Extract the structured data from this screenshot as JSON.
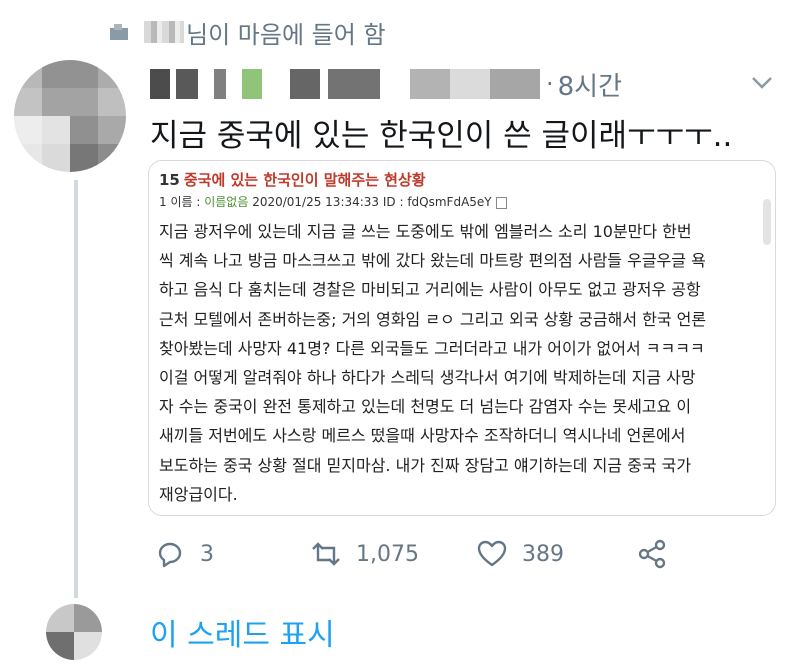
{
  "social_context": {
    "text": "님이 마음에 들어 함",
    "icon": "heart-liked-icon"
  },
  "tweet": {
    "time": "8시간",
    "dot": "·",
    "text": "지금 중국에 있는 한국인이 쓴 글이래ㅜㅜㅜ..",
    "quote": {
      "number": "15",
      "title": "중국에 있는 한국인이 말해주는 현상황",
      "meta_prefix": "1 이름 : ",
      "meta_name": "이름없음",
      "meta_rest": " 2020/01/25 13:34:33 ID : fdQsmFdA5eY",
      "lines": [
        "지금 광저우에 있는데 지금 글 쓰는 도중에도 밖에 엠블러스 소리 10분만다 한번",
        "씩 계속 나고 방금 마스크쓰고 밖에 갔다 왔는데 마트랑 편의점 사람들 우글우글 욕",
        "하고 음식 다 훔치는데 경찰은 마비되고 거리에는 사람이 아무도 없고 광저우 공항",
        "근처 모텔에서 존버하는중; 거의 영화임 ㄹㅇ 그리고 외국 상황 궁금해서 한국 언론",
        "찾아봤는데 사망자 41명? 다른 외국들도 그러더라고 내가 어이가 없어서 ㅋㅋㅋㅋ",
        "이걸 어떻게 알려줘야 하나 하다가 스레딕 생각나서 여기에 박제하는데 지금 사망",
        "자 수는 중국이 완전 통제하고 있는데 천명도 더 넘는다 감염자 수는 못세고요 이",
        "새끼들 저번에도 사스랑 메르스 떴을때 사망자수 조작하더니 역시나네 언론에서",
        "보도하는 중국 상황 절대 믿지마삼. 내가 진짜 장담고 얘기하는데 지금 중국 국가",
        "재앙급이다."
      ]
    },
    "actions": {
      "reply_count": "3",
      "retweet_count": "1,075",
      "like_count": "389"
    }
  },
  "show_thread": "이 스레드 표시",
  "colors": {
    "secondary_text": "#657786",
    "link_blue": "#1da1f2",
    "quote_title_red": "#c0392b",
    "thread_line": "#cfd9de"
  }
}
